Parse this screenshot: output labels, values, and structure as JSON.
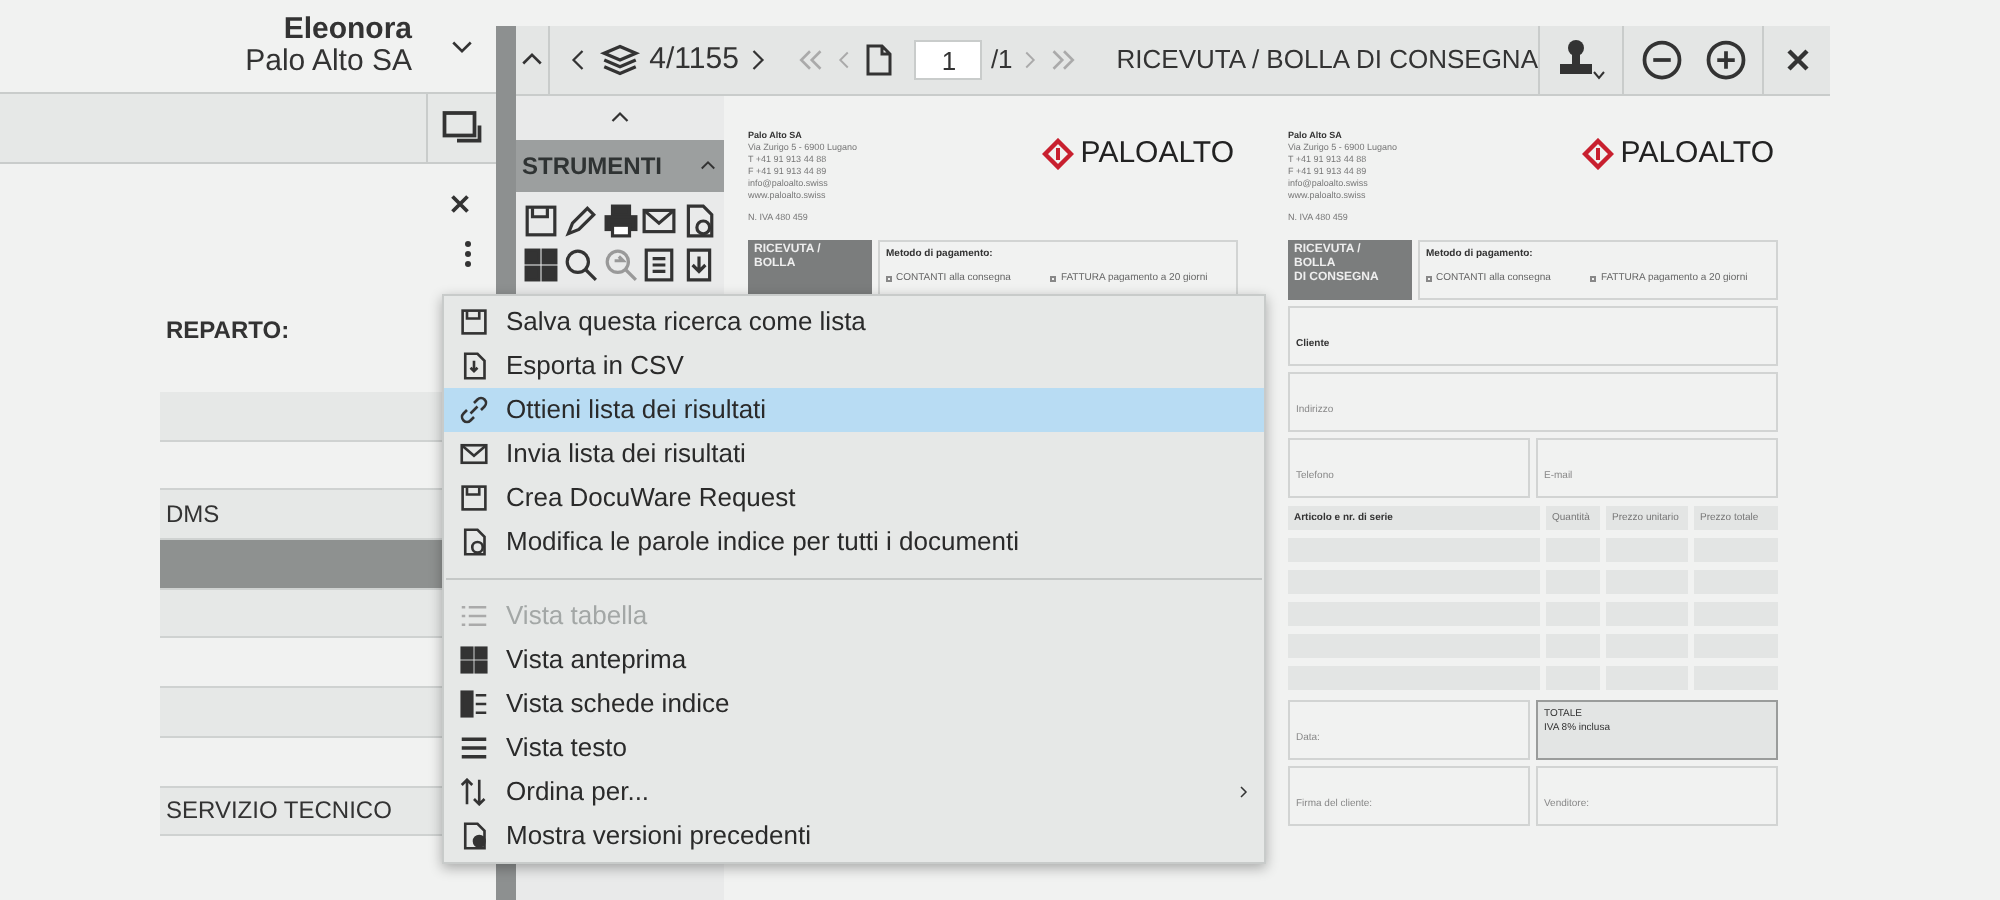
{
  "user": {
    "name": "Eleonora",
    "company": "Palo Alto SA"
  },
  "left_panel": {
    "field_label": "REPARTO:",
    "rows": [
      {
        "kind": "band",
        "selected": false
      },
      {
        "kind": "plain",
        "selected": false
      },
      {
        "kind": "band",
        "selected": false,
        "text": "DMS"
      },
      {
        "selected": true
      },
      {
        "kind": "band",
        "selected": false
      },
      {
        "kind": "plain",
        "selected": false
      },
      {
        "kind": "band",
        "selected": false
      },
      {
        "kind": "plain",
        "selected": false
      },
      {
        "kind": "band",
        "selected": false,
        "text": "SERVIZIO TECNICO"
      }
    ]
  },
  "toolbar": {
    "counter": "4/1155",
    "page_input": "1",
    "page_total": "/1",
    "title": "RICEVUTA / BOLLA DI CONSEGNA"
  },
  "tools_panel": {
    "title": "STRUMENTI"
  },
  "pages": [
    {
      "company_lines": [
        "Palo Alto SA",
        "Via Zurigo 5 - 6900 Lugano",
        "T +41 91 913 44 88",
        "F +41 91 913 44 89",
        "info@paloalto.swiss",
        "www.paloalto.swiss",
        "N. IVA 480 459"
      ],
      "logo": "PALOALTO",
      "title_lines": [
        "RICEVUTA /",
        "BOLLA"
      ],
      "payment_label": "Metodo di pagamento:",
      "payment_options": [
        "CONTANTI alla consegna",
        "FATTURA pagamento a 20 giorni"
      ]
    },
    {
      "company_lines": [
        "Palo Alto SA",
        "Via Zurigo 5 - 6900 Lugano",
        "T +41 91 913 44 88",
        "F +41 91 913 44 89",
        "info@paloalto.swiss",
        "www.paloalto.swiss",
        "N. IVA 480 459"
      ],
      "logo": "PALOALTO",
      "title_lines": [
        "RICEVUTA /",
        "BOLLA",
        "DI CONSEGNA"
      ],
      "payment_label": "Metodo di pagamento:",
      "payment_options": [
        "CONTANTI alla consegna",
        "FATTURA pagamento a 20 giorni"
      ],
      "customer": "Cliente",
      "address": "Indirizzo",
      "phone": "Telefono",
      "email": "E-mail",
      "table_columns": [
        "Articolo e nr. di serie",
        "Quantità",
        "Prezzo unitario",
        "Prezzo totale"
      ],
      "date": "Data:",
      "total": "TOTALE",
      "vat": "IVA 8% inclusa",
      "signature": "Firma del cliente:",
      "seller": "Venditore:"
    }
  ],
  "menu": [
    {
      "kind": "item",
      "label": "Salva questa ricerca come lista",
      "selected": false,
      "disabled": false
    },
    {
      "kind": "item",
      "label": "Esporta in CSV",
      "selected": false,
      "disabled": false
    },
    {
      "kind": "item",
      "label": "Ottieni lista dei risultati",
      "selected": true,
      "disabled": false
    },
    {
      "kind": "item",
      "label": "Invia lista dei risultati",
      "selected": false,
      "disabled": false
    },
    {
      "kind": "item",
      "label": "Crea DocuWare Request",
      "selected": false,
      "disabled": false
    },
    {
      "kind": "item",
      "label": "Modifica le parole indice per tutti i documenti",
      "selected": false,
      "disabled": false
    },
    {
      "kind": "separator"
    },
    {
      "kind": "item",
      "label": "Vista tabella",
      "selected": false,
      "disabled": true
    },
    {
      "kind": "item",
      "label": "Vista anteprima",
      "selected": false,
      "disabled": false
    },
    {
      "kind": "item",
      "label": "Vista schede indice",
      "selected": false,
      "disabled": false
    },
    {
      "kind": "item",
      "label": "Vista testo",
      "selected": false,
      "disabled": false
    },
    {
      "kind": "item",
      "label": "Ordina per...",
      "selected": false,
      "disabled": false,
      "submenu": true
    },
    {
      "kind": "item",
      "label": "Mostra versioni precedenti",
      "selected": false,
      "disabled": false
    }
  ]
}
